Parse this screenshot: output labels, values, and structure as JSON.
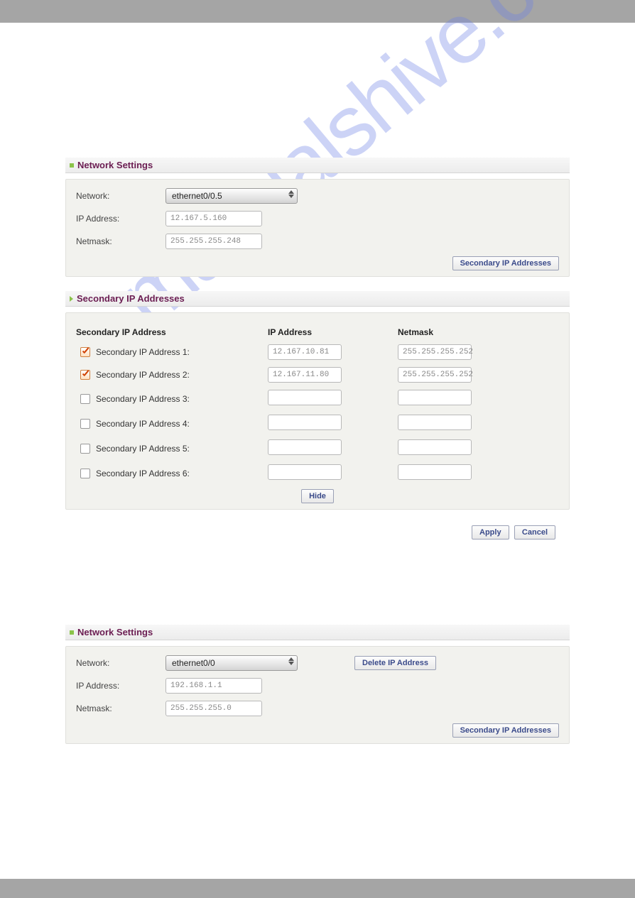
{
  "watermark": "manualshive.com",
  "section1": {
    "title": "Network Settings",
    "network_label": "Network:",
    "network_value": "ethernet0/0.5",
    "ip_label": "IP Address:",
    "ip_value": "12.167.5.160",
    "netmask_label": "Netmask:",
    "netmask_value": "255.255.255.248",
    "secondary_btn": "Secondary IP Addresses"
  },
  "section2": {
    "title": "Secondary IP Addresses",
    "col1": "Secondary IP Address",
    "col2": "IP Address",
    "col3": "Netmask",
    "rows": [
      {
        "label": "Secondary IP Address 1:",
        "checked": true,
        "ip": "12.167.10.81",
        "mask": "255.255.255.252"
      },
      {
        "label": "Secondary IP Address 2:",
        "checked": true,
        "ip": "12.167.11.80",
        "mask": "255.255.255.252"
      },
      {
        "label": "Secondary IP Address 3:",
        "checked": false,
        "ip": "",
        "mask": ""
      },
      {
        "label": "Secondary IP Address 4:",
        "checked": false,
        "ip": "",
        "mask": ""
      },
      {
        "label": "Secondary IP Address 5:",
        "checked": false,
        "ip": "",
        "mask": ""
      },
      {
        "label": "Secondary IP Address 6:",
        "checked": false,
        "ip": "",
        "mask": ""
      }
    ],
    "hide_btn": "Hide"
  },
  "actions": {
    "apply": "Apply",
    "cancel": "Cancel"
  },
  "section3": {
    "title": "Network Settings",
    "network_label": "Network:",
    "network_value": "ethernet0/0",
    "delete_btn": "Delete IP Address",
    "ip_label": "IP Address:",
    "ip_value": "192.168.1.1",
    "netmask_label": "Netmask:",
    "netmask_value": "255.255.255.0",
    "secondary_btn": "Secondary IP Addresses"
  }
}
